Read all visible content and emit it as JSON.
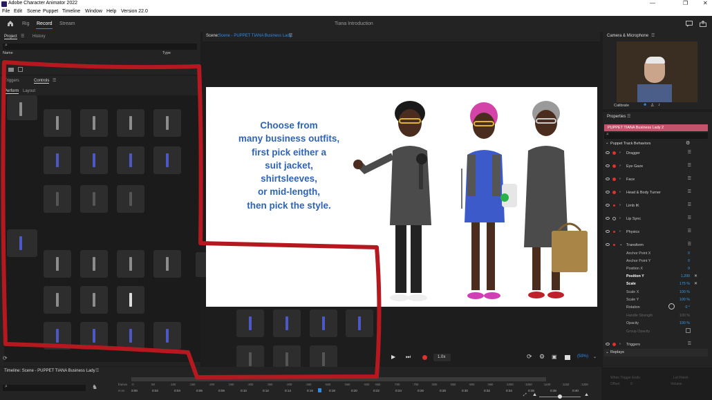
{
  "window": {
    "title": "Adobe Character Animator 2022",
    "controls": [
      "—",
      "❐",
      "✕"
    ]
  },
  "menu": [
    "File",
    "Edit",
    "Scene",
    "Puppet",
    "Timeline",
    "Window",
    "Help",
    "Version 22.0"
  ],
  "topbar": {
    "tabs": [
      "Rig",
      "Record",
      "Stream"
    ],
    "active_tab": "Record",
    "doc_title": "Tiana Introduction"
  },
  "project": {
    "tabs": [
      "Project",
      "History"
    ],
    "columns": [
      "Name",
      "Type"
    ]
  },
  "controls_panel": {
    "tabs": [
      "Triggers",
      "Controls"
    ],
    "subtabs": [
      "Perform",
      "Layout"
    ]
  },
  "scene": {
    "title_prefix": "Scene:",
    "title_link": "Scene - PUPPET TIANA Business Lady",
    "caption_lines": [
      "Choose from",
      "many business outfits,",
      "first pick either a",
      "suit jacket,",
      "shirtsleeves,",
      "or mid-length,",
      "then pick the style."
    ]
  },
  "transport": {
    "speed": "1.0x",
    "zoom": "(59%)"
  },
  "camera": {
    "title": "Camera & Microphone",
    "calibrate": "Calibrate"
  },
  "properties": {
    "title": "Properties",
    "puppet_name": "PUPPET TIANA Business Lady 2",
    "section": "Puppet Track Behaviors",
    "behaviors": [
      "Dragger",
      "Eye Gaze",
      "Face",
      "Head & Body Turner",
      "Limb IK",
      "Lip Sync",
      "Physics",
      "Transform"
    ],
    "transform_params": [
      {
        "label": "Anchor Point X",
        "value": "0"
      },
      {
        "label": "Anchor Point Y",
        "value": "0"
      },
      {
        "label": "Position X",
        "value": "0"
      },
      {
        "label": "Position Y",
        "value": "1,200"
      },
      {
        "label": "Scale",
        "value": "175 %"
      },
      {
        "label": "Scale X",
        "value": "100 %"
      },
      {
        "label": "Scale Y",
        "value": "100 %"
      },
      {
        "label": "Rotation",
        "value": "0 °"
      },
      {
        "label": "Handle Strength",
        "value": "100 %"
      },
      {
        "label": "Opacity",
        "value": "100 %"
      },
      {
        "label": "Group Opacity",
        "value": ""
      }
    ],
    "triggers": "Triggers",
    "replays": "Replays",
    "replay_fields": [
      "When Trigger Ends",
      "Offset",
      "Volume"
    ],
    "replay_values": [
      "Let Finish",
      "0"
    ]
  },
  "timeline": {
    "title": "Timeline: Scene - PUPPET TIANA Business Lady",
    "row_labels": [
      "frames",
      "m:ss"
    ],
    "frames": [
      ":0",
      ":50",
      ":100",
      ":150",
      ":200",
      ":250",
      ":300",
      ":350",
      ":400",
      ":450",
      ":500",
      ":550",
      ":600",
      ":650",
      ":700",
      ":750",
      ":800",
      ":850",
      ":900",
      ":950",
      ":1000",
      ":1050",
      ":1100",
      ":1150",
      ":1200"
    ],
    "times": [
      "0:00",
      "0:02",
      "0:04",
      "0:06",
      "0:08",
      "0:10",
      "0:12",
      "0:14",
      "0:16",
      "0:18",
      "0:20",
      "0:22",
      "0:24",
      "0:26",
      "0:28",
      "0:30",
      "0:32",
      "0:34",
      "0:36",
      "0:38",
      "0:40"
    ]
  },
  "colors": {
    "accent": "#2d8ceb",
    "record": "#e0312c",
    "annotation": "#b5191f",
    "puppet_bar": "#c4526a",
    "caption": "#2f63b5"
  }
}
